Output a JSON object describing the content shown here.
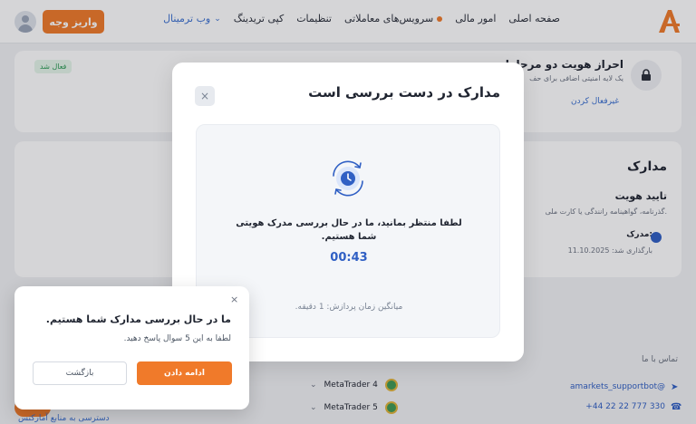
{
  "header": {
    "deposit_label": "واریز وجه",
    "nav": [
      {
        "label": "صفحه اصلی"
      },
      {
        "label": "امور مالی"
      },
      {
        "label": "سرویس‌های معاملاتی"
      },
      {
        "label": "تنظیمات"
      },
      {
        "label": "کپی تریدینگ"
      },
      {
        "label": "وب ترمینال"
      }
    ]
  },
  "twofa": {
    "title": "احراز هویت دو مرحله‌ای",
    "subtitle": "یک لایه امنیتی اضافی برای حف",
    "status": "فعال شد",
    "disable_link": "غیرفعال کردن"
  },
  "documents": {
    "title": "مدارک",
    "id_title": "تایید هویت",
    "id_subtitle": "گذرنامه، گواهینامه رانندگی یا کارت ملی.",
    "doc_label": "مدرک:",
    "uploaded": "بارگذاری شد: 11.10.2025"
  },
  "footer": {
    "contact_title": "تماس با ما",
    "telegram": "amarkets_supportbot@",
    "phone": "+44 22 22 777 330",
    "mt4": "MetaTrader 4",
    "mt5": "MetaTrader 5",
    "bottom_link": "دسترسی به منابع آمارکتس"
  },
  "modal": {
    "title": "مدارک در دست بررسی است",
    "close": "×",
    "message": "لطفا منتظر بمانید، ما در حال بررسی مدرک هویتی شما هستیم.",
    "timer": "00:43",
    "avg_time": "میانگین زمان پردازش: 1 دقیقه."
  },
  "survey": {
    "close": "×",
    "title": "ما در حال بررسی مدارک شما هستیم.",
    "subtitle": "لطفا به این 5 سوال پاسخ دهید.",
    "continue_label": "ادامه دادن",
    "back_label": "بازگشت"
  },
  "colors": {
    "accent": "#f07a2a",
    "link": "#2f5fc4",
    "success": "#2a9a53"
  }
}
